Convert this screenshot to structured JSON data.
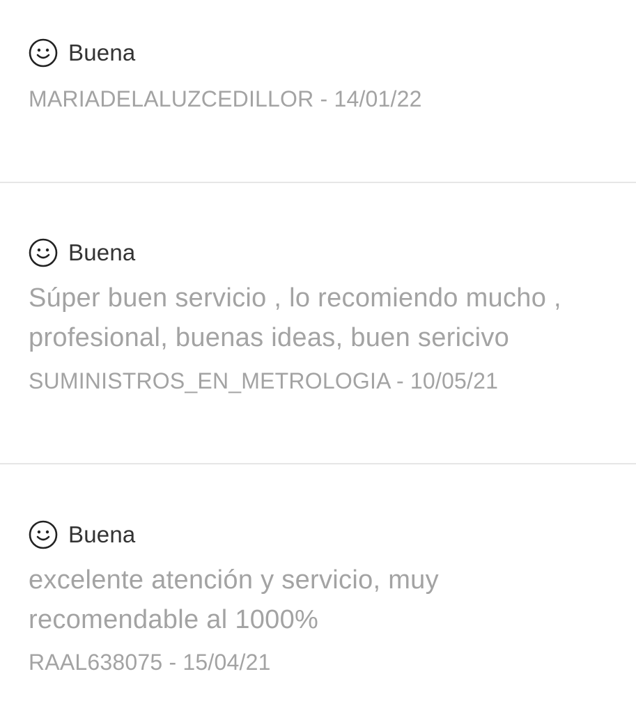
{
  "reviews": [
    {
      "rating_icon": "smiley-icon",
      "rating": "Buena",
      "comment": "",
      "meta": "MARIADELALUZCEDILLOR - 14/01/22"
    },
    {
      "rating_icon": "smiley-icon",
      "rating": "Buena",
      "comment": "Súper buen servicio , lo recomiendo mucho , profesional, buenas ideas, buen sericivo",
      "meta": "SUMINISTROS_EN_METROLOGIA - 10/05/21"
    },
    {
      "rating_icon": "smiley-icon",
      "rating": "Buena",
      "comment": "excelente atención y servicio, muy recomendable al 1000%",
      "meta": "RAAL638075 - 15/04/21"
    }
  ],
  "colors": {
    "rating_text": "#333333",
    "secondary_text": "#a3a3a3",
    "divider": "#e6e6e6",
    "background": "#ffffff"
  }
}
